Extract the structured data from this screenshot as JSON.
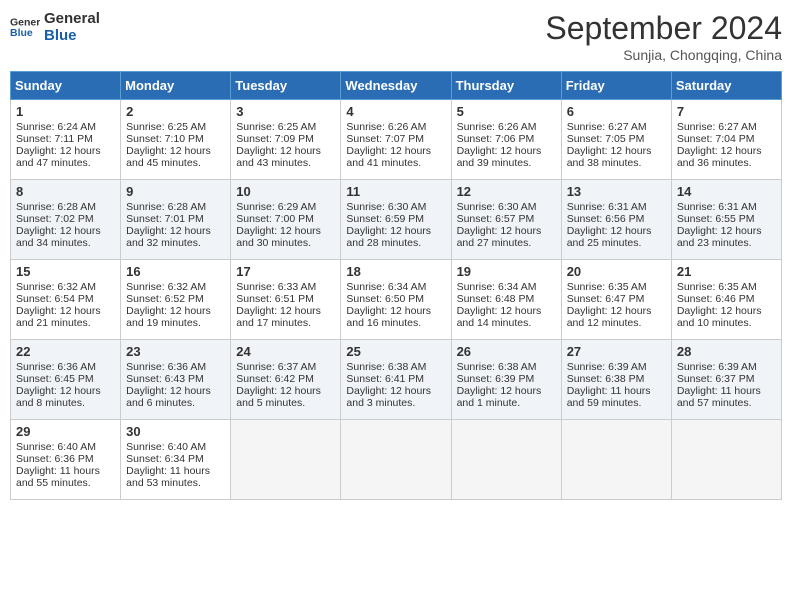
{
  "header": {
    "logo_line1": "General",
    "logo_line2": "Blue",
    "month_year": "September 2024",
    "location": "Sunjia, Chongqing, China"
  },
  "days_of_week": [
    "Sunday",
    "Monday",
    "Tuesday",
    "Wednesday",
    "Thursday",
    "Friday",
    "Saturday"
  ],
  "weeks": [
    [
      {
        "day": "1",
        "lines": [
          "Sunrise: 6:24 AM",
          "Sunset: 7:11 PM",
          "Daylight: 12 hours",
          "and 47 minutes."
        ]
      },
      {
        "day": "2",
        "lines": [
          "Sunrise: 6:25 AM",
          "Sunset: 7:10 PM",
          "Daylight: 12 hours",
          "and 45 minutes."
        ]
      },
      {
        "day": "3",
        "lines": [
          "Sunrise: 6:25 AM",
          "Sunset: 7:09 PM",
          "Daylight: 12 hours",
          "and 43 minutes."
        ]
      },
      {
        "day": "4",
        "lines": [
          "Sunrise: 6:26 AM",
          "Sunset: 7:07 PM",
          "Daylight: 12 hours",
          "and 41 minutes."
        ]
      },
      {
        "day": "5",
        "lines": [
          "Sunrise: 6:26 AM",
          "Sunset: 7:06 PM",
          "Daylight: 12 hours",
          "and 39 minutes."
        ]
      },
      {
        "day": "6",
        "lines": [
          "Sunrise: 6:27 AM",
          "Sunset: 7:05 PM",
          "Daylight: 12 hours",
          "and 38 minutes."
        ]
      },
      {
        "day": "7",
        "lines": [
          "Sunrise: 6:27 AM",
          "Sunset: 7:04 PM",
          "Daylight: 12 hours",
          "and 36 minutes."
        ]
      }
    ],
    [
      {
        "day": "8",
        "lines": [
          "Sunrise: 6:28 AM",
          "Sunset: 7:02 PM",
          "Daylight: 12 hours",
          "and 34 minutes."
        ]
      },
      {
        "day": "9",
        "lines": [
          "Sunrise: 6:28 AM",
          "Sunset: 7:01 PM",
          "Daylight: 12 hours",
          "and 32 minutes."
        ]
      },
      {
        "day": "10",
        "lines": [
          "Sunrise: 6:29 AM",
          "Sunset: 7:00 PM",
          "Daylight: 12 hours",
          "and 30 minutes."
        ]
      },
      {
        "day": "11",
        "lines": [
          "Sunrise: 6:30 AM",
          "Sunset: 6:59 PM",
          "Daylight: 12 hours",
          "and 28 minutes."
        ]
      },
      {
        "day": "12",
        "lines": [
          "Sunrise: 6:30 AM",
          "Sunset: 6:57 PM",
          "Daylight: 12 hours",
          "and 27 minutes."
        ]
      },
      {
        "day": "13",
        "lines": [
          "Sunrise: 6:31 AM",
          "Sunset: 6:56 PM",
          "Daylight: 12 hours",
          "and 25 minutes."
        ]
      },
      {
        "day": "14",
        "lines": [
          "Sunrise: 6:31 AM",
          "Sunset: 6:55 PM",
          "Daylight: 12 hours",
          "and 23 minutes."
        ]
      }
    ],
    [
      {
        "day": "15",
        "lines": [
          "Sunrise: 6:32 AM",
          "Sunset: 6:54 PM",
          "Daylight: 12 hours",
          "and 21 minutes."
        ]
      },
      {
        "day": "16",
        "lines": [
          "Sunrise: 6:32 AM",
          "Sunset: 6:52 PM",
          "Daylight: 12 hours",
          "and 19 minutes."
        ]
      },
      {
        "day": "17",
        "lines": [
          "Sunrise: 6:33 AM",
          "Sunset: 6:51 PM",
          "Daylight: 12 hours",
          "and 17 minutes."
        ]
      },
      {
        "day": "18",
        "lines": [
          "Sunrise: 6:34 AM",
          "Sunset: 6:50 PM",
          "Daylight: 12 hours",
          "and 16 minutes."
        ]
      },
      {
        "day": "19",
        "lines": [
          "Sunrise: 6:34 AM",
          "Sunset: 6:48 PM",
          "Daylight: 12 hours",
          "and 14 minutes."
        ]
      },
      {
        "day": "20",
        "lines": [
          "Sunrise: 6:35 AM",
          "Sunset: 6:47 PM",
          "Daylight: 12 hours",
          "and 12 minutes."
        ]
      },
      {
        "day": "21",
        "lines": [
          "Sunrise: 6:35 AM",
          "Sunset: 6:46 PM",
          "Daylight: 12 hours",
          "and 10 minutes."
        ]
      }
    ],
    [
      {
        "day": "22",
        "lines": [
          "Sunrise: 6:36 AM",
          "Sunset: 6:45 PM",
          "Daylight: 12 hours",
          "and 8 minutes."
        ]
      },
      {
        "day": "23",
        "lines": [
          "Sunrise: 6:36 AM",
          "Sunset: 6:43 PM",
          "Daylight: 12 hours",
          "and 6 minutes."
        ]
      },
      {
        "day": "24",
        "lines": [
          "Sunrise: 6:37 AM",
          "Sunset: 6:42 PM",
          "Daylight: 12 hours",
          "and 5 minutes."
        ]
      },
      {
        "day": "25",
        "lines": [
          "Sunrise: 6:38 AM",
          "Sunset: 6:41 PM",
          "Daylight: 12 hours",
          "and 3 minutes."
        ]
      },
      {
        "day": "26",
        "lines": [
          "Sunrise: 6:38 AM",
          "Sunset: 6:39 PM",
          "Daylight: 12 hours",
          "and 1 minute."
        ]
      },
      {
        "day": "27",
        "lines": [
          "Sunrise: 6:39 AM",
          "Sunset: 6:38 PM",
          "Daylight: 11 hours",
          "and 59 minutes."
        ]
      },
      {
        "day": "28",
        "lines": [
          "Sunrise: 6:39 AM",
          "Sunset: 6:37 PM",
          "Daylight: 11 hours",
          "and 57 minutes."
        ]
      }
    ],
    [
      {
        "day": "29",
        "lines": [
          "Sunrise: 6:40 AM",
          "Sunset: 6:36 PM",
          "Daylight: 11 hours",
          "and 55 minutes."
        ]
      },
      {
        "day": "30",
        "lines": [
          "Sunrise: 6:40 AM",
          "Sunset: 6:34 PM",
          "Daylight: 11 hours",
          "and 53 minutes."
        ]
      },
      {
        "day": "",
        "lines": []
      },
      {
        "day": "",
        "lines": []
      },
      {
        "day": "",
        "lines": []
      },
      {
        "day": "",
        "lines": []
      },
      {
        "day": "",
        "lines": []
      }
    ]
  ]
}
